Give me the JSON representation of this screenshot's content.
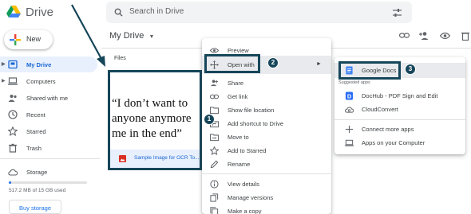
{
  "app": {
    "name": "Drive"
  },
  "search": {
    "placeholder": "Search in Drive"
  },
  "new_button": {
    "label": "New"
  },
  "sidebar": {
    "items": [
      {
        "label": "My Drive",
        "icon": "my-drive-icon"
      },
      {
        "label": "Computers",
        "icon": "computer-icon"
      },
      {
        "label": "Shared with me",
        "icon": "shared-icon"
      },
      {
        "label": "Recent",
        "icon": "clock-icon"
      },
      {
        "label": "Starred",
        "icon": "star-icon"
      },
      {
        "label": "Trash",
        "icon": "trash-icon"
      }
    ],
    "storage": {
      "label": "Storage",
      "used_text": "517.2 MB of 15 GB used",
      "used_fraction": 0.034
    },
    "buy_storage": "Buy storage"
  },
  "main": {
    "title": "My Drive",
    "files_label": "Files",
    "file": {
      "name": "Sample Image for OCR To...",
      "preview_lines": [
        "“I don’t want to",
        "anyone anymore",
        "me in the end”"
      ]
    }
  },
  "context_menu": {
    "items": [
      {
        "label": "Preview",
        "icon": "eye-icon"
      },
      {
        "label": "Open with",
        "icon": "move-icon"
      },
      {
        "label": "Share",
        "icon": "share-person-icon"
      },
      {
        "label": "Get link",
        "icon": "link-icon"
      },
      {
        "label": "Show file location",
        "icon": "folder-icon"
      },
      {
        "label": "Add shortcut to Drive",
        "icon": "shortcut-icon"
      },
      {
        "label": "Move to",
        "icon": "move-to-icon"
      },
      {
        "label": "Add to Starred",
        "icon": "star-outline-icon"
      },
      {
        "label": "Rename",
        "icon": "pencil-icon"
      },
      {
        "label": "View details",
        "icon": "info-icon"
      },
      {
        "label": "Manage versions",
        "icon": "versions-icon"
      },
      {
        "label": "Make a copy",
        "icon": "copy-icon"
      }
    ]
  },
  "open_with_menu": {
    "primary": {
      "label": "Google Docs",
      "icon": "google-docs-icon"
    },
    "suggested_caption": "Suggested apps",
    "suggested": [
      {
        "label": "DocHub - PDF Sign and Edit",
        "icon": "dochub-icon"
      },
      {
        "label": "CloudConvert",
        "icon": "cloudconvert-icon"
      }
    ],
    "more": [
      {
        "label": "Connect more apps",
        "icon": "plus-icon"
      },
      {
        "label": "Apps on your Computer",
        "icon": "laptop-icon"
      }
    ]
  },
  "callouts": [
    "1",
    "2",
    "3"
  ],
  "colors": {
    "accent": "#1a73e8",
    "highlight": "#16465a",
    "active_bg": "#e8f0fe"
  }
}
